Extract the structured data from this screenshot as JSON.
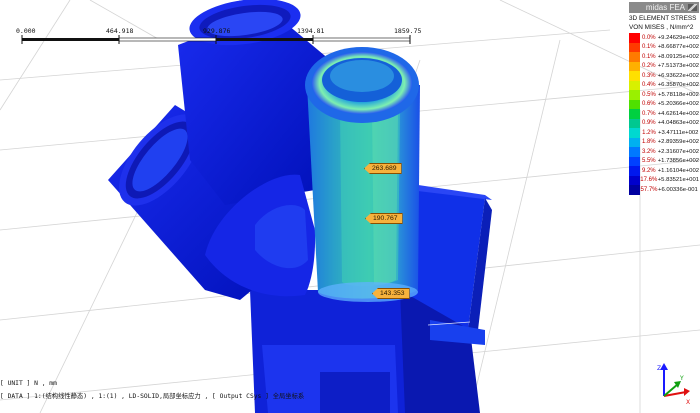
{
  "app": {
    "brand": "midas FEA"
  },
  "scale_bar": {
    "ticks": [
      "0.000",
      "464.918",
      "929.876",
      "1394.81",
      "1859.75"
    ]
  },
  "legend": {
    "title_line1": "3D ELEMENT STRESS",
    "title_line2": "VON MISES , N/mm^2",
    "rows": [
      {
        "color": "#ff0000",
        "percent": "0.0%",
        "value": "+9.24629e+002"
      },
      {
        "color": "#ff3a00",
        "percent": "0.1%",
        "value": "+8.66877e+002"
      },
      {
        "color": "#ff7a00",
        "percent": "0.1%",
        "value": "+8.09125e+002"
      },
      {
        "color": "#ffb000",
        "percent": "0.2%",
        "value": "+7.51373e+002"
      },
      {
        "color": "#ffe000",
        "percent": "0.3%",
        "value": "+6.93622e+002"
      },
      {
        "color": "#d8f000",
        "percent": "0.4%",
        "value": "+6.35870e+002"
      },
      {
        "color": "#9af000",
        "percent": "0.5%",
        "value": "+5.78118e+002"
      },
      {
        "color": "#4fe000",
        "percent": "0.6%",
        "value": "+5.20366e+002"
      },
      {
        "color": "#00d040",
        "percent": "0.7%",
        "value": "+4.62614e+002"
      },
      {
        "color": "#00c890",
        "percent": "0.9%",
        "value": "+4.04863e+002"
      },
      {
        "color": "#00d8d0",
        "percent": "1.2%",
        "value": "+3.47111e+002"
      },
      {
        "color": "#00b0f0",
        "percent": "1.8%",
        "value": "+2.89359e+002"
      },
      {
        "color": "#0078ff",
        "percent": "3.2%",
        "value": "+2.31607e+002"
      },
      {
        "color": "#0040ff",
        "percent": "5.5%",
        "value": "+1.73856e+002"
      },
      {
        "color": "#0018ee",
        "percent": "9.2%",
        "value": "+1.16104e+002"
      },
      {
        "color": "#0000cc",
        "percent": "17.6%",
        "value": "+5.83521e+001"
      },
      {
        "color": "#0000a0",
        "percent": "57.7%",
        "value": "+6.00336e-001"
      }
    ]
  },
  "callouts": [
    "263.689",
    "190.767",
    "143.353"
  ],
  "messages": {
    "line1": "[ UNIT ] N , mm",
    "line2": "[ DATA ] 1:(结构线性静态) , 1:(1) , LD-SOLID,局部坐标应力 , [ Output CSys ] 全局坐标系"
  },
  "triad": {
    "axes": [
      "X",
      "Y",
      "Z"
    ]
  }
}
